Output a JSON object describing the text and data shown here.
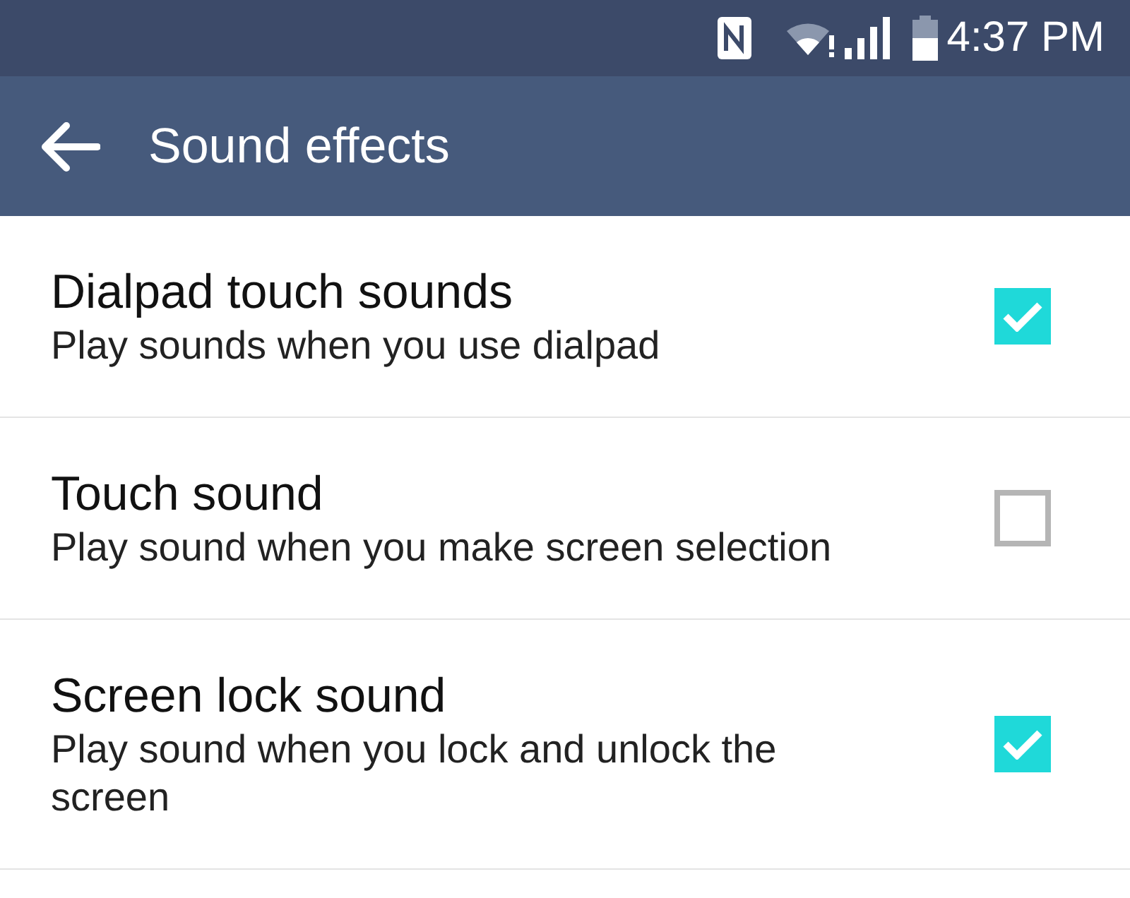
{
  "status_bar": {
    "time": "4:37 PM"
  },
  "app_bar": {
    "title": "Sound effects"
  },
  "settings": [
    {
      "title": "Dialpad touch sounds",
      "summary": "Play sounds when you use dialpad",
      "checked": true
    },
    {
      "title": "Touch sound",
      "summary": "Play sound when you make screen selection",
      "checked": false
    },
    {
      "title": "Screen lock sound",
      "summary": "Play sound when you lock and unlock the screen",
      "checked": true
    }
  ]
}
